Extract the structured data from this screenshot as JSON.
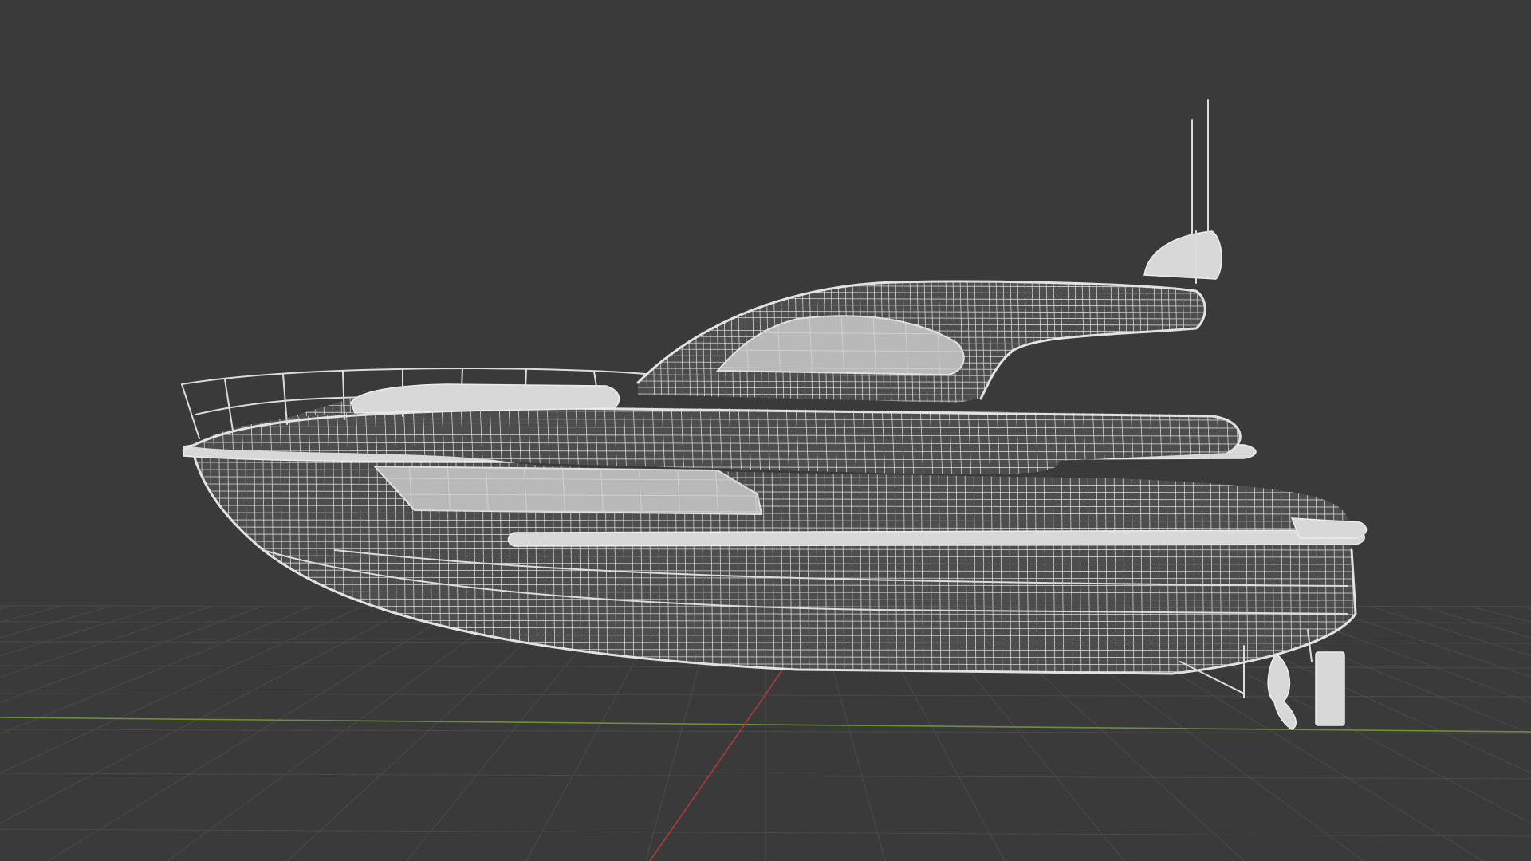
{
  "viewport": {
    "background": "#3a3a3a",
    "grid_color": "#4a4a4a",
    "x_axis_color": "#6b8f3a",
    "y_axis_color": "#b03a3a",
    "wireframe_color": "#d0d0d0"
  },
  "scene": {
    "object": "motor-yacht-wireframe",
    "shading": "wireframe"
  }
}
